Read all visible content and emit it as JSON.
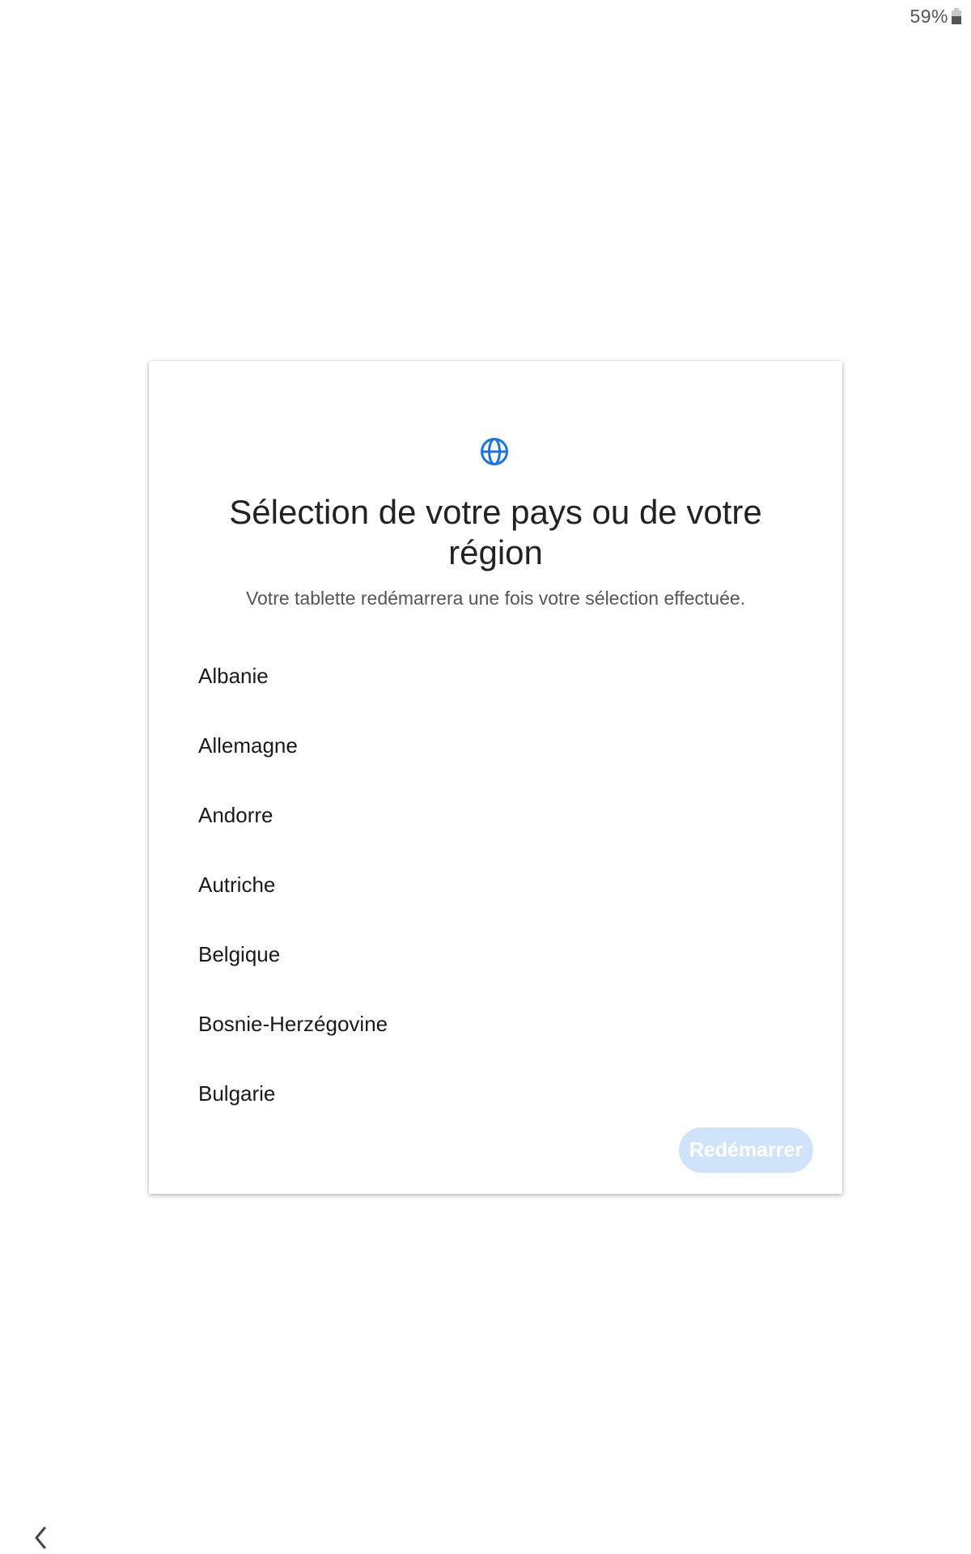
{
  "status_bar": {
    "battery_percent_label": "59%",
    "battery_level": 0.59
  },
  "dialog": {
    "icon": "globe-icon",
    "accent_color": "#1a73e8",
    "title": "Sélection de votre pays ou de votre région",
    "subtitle": "Votre tablette redémarrera une fois votre sélection effectuée.",
    "countries": [
      {
        "label": "Albanie"
      },
      {
        "label": "Allemagne"
      },
      {
        "label": "Andorre"
      },
      {
        "label": "Autriche"
      },
      {
        "label": "Belgique"
      },
      {
        "label": "Bosnie-Herzégovine"
      },
      {
        "label": "Bulgarie"
      }
    ],
    "restart_button": {
      "label": "Redémarrer",
      "enabled": false,
      "color": "#cfe4fa"
    }
  },
  "navigation": {
    "back_icon": "chevron-left-icon"
  }
}
